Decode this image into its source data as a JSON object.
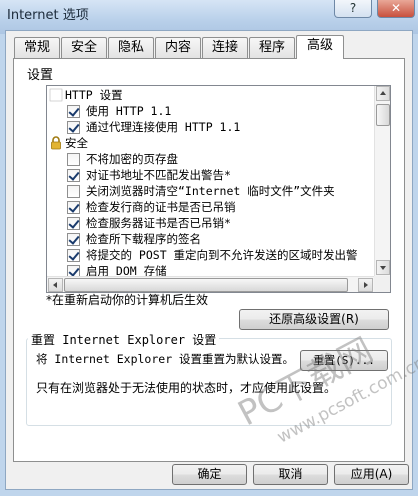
{
  "window": {
    "title": "Internet 选项",
    "help_label": "?",
    "close_label": "✕"
  },
  "tabs": [
    {
      "label": "常规",
      "active": false
    },
    {
      "label": "安全",
      "active": false
    },
    {
      "label": "隐私",
      "active": false
    },
    {
      "label": "内容",
      "active": false
    },
    {
      "label": "连接",
      "active": false
    },
    {
      "label": "程序",
      "active": false
    },
    {
      "label": "高级",
      "active": true
    }
  ],
  "settings": {
    "label": "设置",
    "items": [
      {
        "kind": "category",
        "icon": "globe-icon",
        "label": "HTTP 设置"
      },
      {
        "kind": "checkbox",
        "checked": true,
        "label": "使用 HTTP 1.1"
      },
      {
        "kind": "checkbox",
        "checked": true,
        "label": "通过代理连接使用 HTTP 1.1"
      },
      {
        "kind": "category",
        "icon": "lock-icon",
        "label": "安全"
      },
      {
        "kind": "checkbox",
        "checked": false,
        "label": "不将加密的页存盘"
      },
      {
        "kind": "checkbox",
        "checked": true,
        "label": "对证书地址不匹配发出警告*"
      },
      {
        "kind": "checkbox",
        "checked": false,
        "label": "关闭浏览器时清空“Internet 临时文件”文件夹"
      },
      {
        "kind": "checkbox",
        "checked": true,
        "label": "检查发行商的证书是否已吊销"
      },
      {
        "kind": "checkbox",
        "checked": true,
        "label": "检查服务器证书是否已吊销*"
      },
      {
        "kind": "checkbox",
        "checked": true,
        "label": "检查所下载程序的签名"
      },
      {
        "kind": "checkbox",
        "checked": true,
        "label": "将提交的 POST 重定向到不允许发送的区域时发出警"
      },
      {
        "kind": "checkbox",
        "checked": true,
        "label": "启用 DOM 存储"
      }
    ],
    "restart_note": "*在重新启动你的计算机后生效",
    "restore_button": "还原高级设置(R)"
  },
  "reset": {
    "group_title": "重置 Internet Explorer 设置",
    "description": "将 Internet Explorer 设置重置为默认设置。",
    "button": "重置(S)...",
    "warning": "只有在浏览器处于无法使用的状态时，才应使用此设置。"
  },
  "footer": {
    "ok": "确定",
    "cancel": "取消",
    "apply": "应用(A)"
  },
  "watermark": {
    "text": "PC下载网",
    "url": "www.pcsoft.com.cn"
  },
  "colors": {
    "titlebar": "#b9d0ea",
    "dialog": "#f0f0f0",
    "check": "#1a3b6c"
  }
}
